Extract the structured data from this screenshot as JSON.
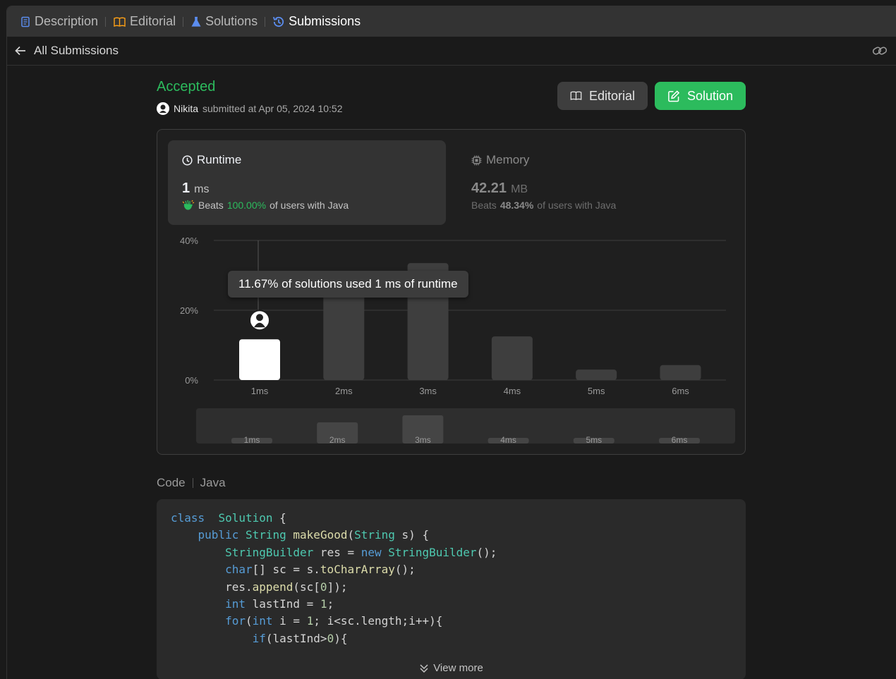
{
  "tabs": [
    {
      "label": "Description",
      "icon": "description-icon",
      "color": "#5b8def"
    },
    {
      "label": "Editorial",
      "icon": "book-icon",
      "color": "#ffa116"
    },
    {
      "label": "Solutions",
      "icon": "flask-icon",
      "color": "#5b8def"
    },
    {
      "label": "Submissions",
      "icon": "history-icon",
      "color": "#5b8def"
    }
  ],
  "subheader": {
    "back_label": "All Submissions"
  },
  "submission": {
    "status": "Accepted",
    "user": "Nikita",
    "submitted_text": "submitted at Apr 05, 2024 10:52"
  },
  "buttons": {
    "editorial": "Editorial",
    "solution": "Solution"
  },
  "runtime": {
    "title": "Runtime",
    "value": "1",
    "unit": "ms",
    "beats_prefix": "Beats",
    "beats_pct": "100.00%",
    "beats_suffix": "of users with Java"
  },
  "memory": {
    "title": "Memory",
    "value": "42.21",
    "unit": "MB",
    "beats_prefix": "Beats",
    "beats_pct": "48.34%",
    "beats_suffix": "of users with Java"
  },
  "tooltip": "11.67% of solutions used 1 ms of runtime",
  "chart_data": {
    "type": "bar",
    "categories": [
      "1ms",
      "2ms",
      "3ms",
      "4ms",
      "5ms",
      "6ms"
    ],
    "values": [
      11.67,
      26,
      33.5,
      12.5,
      3,
      4.3
    ],
    "ylim": [
      0,
      40
    ],
    "yticks": [
      "0%",
      "20%",
      "40%"
    ],
    "highlight_index": 0,
    "grid": true,
    "overview_values": [
      2.5,
      15,
      20,
      3,
      1.5,
      1.5
    ]
  },
  "code": {
    "label": "Code",
    "language": "Java",
    "view_more": "View more",
    "lines": [
      [
        [
          "kw",
          "class"
        ],
        [
          "",
          "  "
        ],
        [
          "ty",
          "Solution"
        ],
        [
          "",
          " {"
        ]
      ],
      [
        [
          "",
          "    "
        ],
        [
          "kw",
          "public"
        ],
        [
          "",
          " "
        ],
        [
          "ty",
          "String"
        ],
        [
          "",
          " "
        ],
        [
          "fn",
          "makeGood"
        ],
        [
          "",
          "("
        ],
        [
          "ty",
          "String"
        ],
        [
          "",
          " s) {"
        ]
      ],
      [
        [
          "",
          "        "
        ],
        [
          "ty",
          "StringBuilder"
        ],
        [
          "",
          " res = "
        ],
        [
          "kw",
          "new"
        ],
        [
          "",
          " "
        ],
        [
          "ty",
          "StringBuilder"
        ],
        [
          "",
          "();"
        ]
      ],
      [
        [
          "",
          "        "
        ],
        [
          "kw",
          "char"
        ],
        [
          "",
          "[] sc = s."
        ],
        [
          "fn",
          "toCharArray"
        ],
        [
          "",
          "();"
        ]
      ],
      [
        [
          "",
          "        res."
        ],
        [
          "fn",
          "append"
        ],
        [
          "",
          "(sc["
        ],
        [
          "nm",
          "0"
        ],
        [
          "",
          "]);"
        ]
      ],
      [
        [
          "",
          "        "
        ],
        [
          "kw",
          "int"
        ],
        [
          "",
          " lastInd = "
        ],
        [
          "nm",
          "1"
        ],
        [
          "",
          ";"
        ]
      ],
      [
        [
          "",
          "        "
        ],
        [
          "kw",
          "for"
        ],
        [
          "",
          "("
        ],
        [
          "kw",
          "int"
        ],
        [
          "",
          " i = "
        ],
        [
          "nm",
          "1"
        ],
        [
          "",
          "; i<sc.length;i++){"
        ]
      ],
      [
        [
          "",
          "            "
        ],
        [
          "kw",
          "if"
        ],
        [
          "",
          "(lastInd>"
        ],
        [
          "nm",
          "0"
        ],
        [
          "",
          "){"
        ]
      ]
    ]
  }
}
